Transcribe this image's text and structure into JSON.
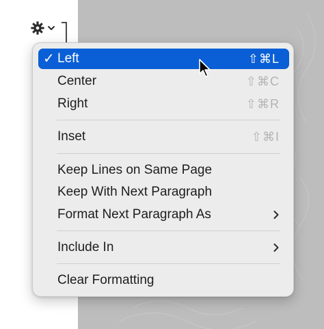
{
  "toolbar": {
    "gear_icon": "gear-icon",
    "dropdown_icon": "chevron-down-icon"
  },
  "menu": {
    "items": [
      {
        "label": "Left",
        "shortcut": "⇧⌘L",
        "checked": true,
        "selected": true
      },
      {
        "label": "Center",
        "shortcut": "⇧⌘C"
      },
      {
        "label": "Right",
        "shortcut": "⇧⌘R"
      },
      {
        "label": "Inset",
        "shortcut": "⇧⌘I"
      },
      {
        "label": "Keep Lines on Same Page"
      },
      {
        "label": "Keep With Next Paragraph"
      },
      {
        "label": "Format Next Paragraph As",
        "submenu": true
      },
      {
        "label": "Include In",
        "submenu": true
      },
      {
        "label": "Clear Formatting"
      }
    ],
    "check_mark": "✓"
  },
  "colors": {
    "selection": "#0a5fd6",
    "menu_background": "#ececec",
    "shortcut_disabled": "#b3b3b3",
    "panel": "#bdbdbd"
  }
}
